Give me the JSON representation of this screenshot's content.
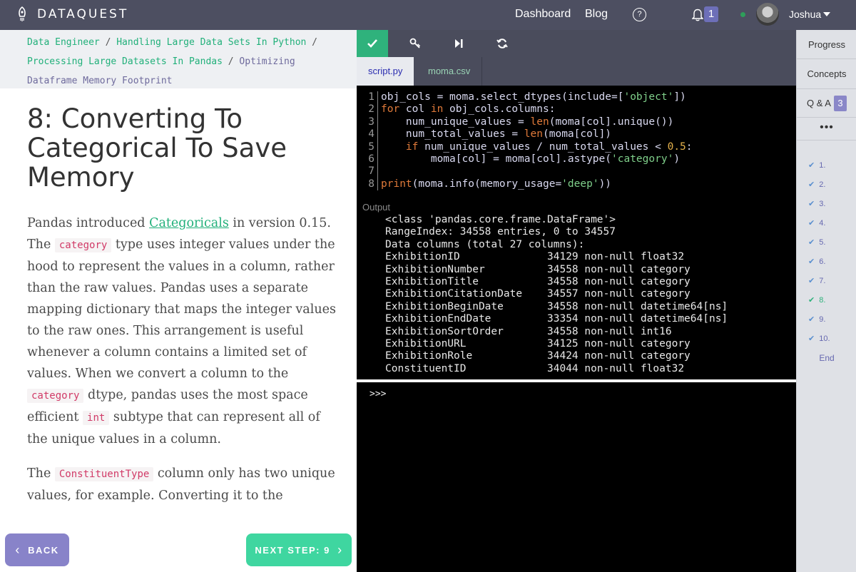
{
  "topbar": {
    "brand": "DATAQUEST",
    "nav": [
      "Dashboard",
      "Blog"
    ],
    "help_icon": "question-bubble-icon",
    "notifications": "1",
    "user": "Joshua"
  },
  "breadcrumb": {
    "items": [
      "Data Engineer",
      "Handling Large Data Sets In Python",
      "Processing Large Datasets In Pandas",
      "Optimizing Dataframe Memory Footprint"
    ],
    "separator": "/"
  },
  "lesson": {
    "title": "8: Converting To Categorical To Save Memory",
    "p1_a": "Pandas introduced ",
    "p1_link": "Categoricals",
    "p1_b": " in version 0.15. The ",
    "p1_code": "category",
    "p1_c": " type uses integer values under the hood to represent the values in a column, rather than the raw values. Pandas uses a separate mapping dictionary that maps the integer values to the raw ones. This arrangement is useful whenever a column contains a limited set of values. When we convert a column to the ",
    "p1_code2": "category",
    "p1_d": " dtype, pandas uses the most space efficient ",
    "p1_code3": "int",
    "p1_e": " subtype that can represent all of the unique values in a column.",
    "p2_a": "The ",
    "p2_code": "ConstituentType",
    "p2_b": " column only has two unique values, for example. Converting it to the"
  },
  "footer": {
    "back_label": "BACK",
    "next_label": "NEXT STEP: 9"
  },
  "editor": {
    "toolbar_icons": [
      "checkmark-icon",
      "key-icon",
      "step-forward-icon",
      "refresh-icon"
    ],
    "tabs": [
      "script.py",
      "moma.csv"
    ],
    "code_lines": [
      {
        "n": "1",
        "parts": [
          [
            "cl",
            "obj_cols = moma.select_dtypes(include=["
          ],
          [
            "str",
            "'object'"
          ],
          [
            "cl",
            "])"
          ]
        ]
      },
      {
        "n": "2",
        "parts": [
          [
            "kw",
            "for"
          ],
          [
            "cl",
            " col "
          ],
          [
            "kw",
            "in"
          ],
          [
            "cl",
            " obj_cols.columns:"
          ]
        ]
      },
      {
        "n": "3",
        "parts": [
          [
            "cl",
            "    num_unique_values = "
          ],
          [
            "kw",
            "len"
          ],
          [
            "cl",
            "(moma[col].unique())"
          ]
        ]
      },
      {
        "n": "4",
        "parts": [
          [
            "cl",
            "    num_total_values = "
          ],
          [
            "kw",
            "len"
          ],
          [
            "cl",
            "(moma[col])"
          ]
        ]
      },
      {
        "n": "5",
        "parts": [
          [
            "cl",
            "    "
          ],
          [
            "kw",
            "if"
          ],
          [
            "cl",
            " num_unique_values / num_total_values < "
          ],
          [
            "num",
            "0.5"
          ],
          [
            "cl",
            ":"
          ]
        ]
      },
      {
        "n": "6",
        "parts": [
          [
            "cl",
            "        moma[col] = moma[col].astype("
          ],
          [
            "str",
            "'category'"
          ],
          [
            "cl",
            ")"
          ]
        ]
      },
      {
        "n": "7",
        "parts": [
          [
            "cl",
            ""
          ]
        ]
      },
      {
        "n": "8",
        "parts": [
          [
            "kw",
            "print"
          ],
          [
            "cl",
            "(moma.info(memory_usage="
          ],
          [
            "str",
            "'deep'"
          ],
          [
            "cl",
            "))"
          ]
        ]
      }
    ],
    "output_label": "Output",
    "output_header": [
      "<class 'pandas.core.frame.DataFrame'>",
      "RangeIndex: 34558 entries, 0 to 34557",
      "Data columns (total 27 columns):"
    ],
    "output_rows": [
      [
        "ExhibitionID",
        "34129 non-null float32"
      ],
      [
        "ExhibitionNumber",
        "34558 non-null category"
      ],
      [
        "ExhibitionTitle",
        "34558 non-null category"
      ],
      [
        "ExhibitionCitationDate",
        "34557 non-null category"
      ],
      [
        "ExhibitionBeginDate",
        "34558 non-null datetime64[ns]"
      ],
      [
        "ExhibitionEndDate",
        "33354 non-null datetime64[ns]"
      ],
      [
        "ExhibitionSortOrder",
        "34558 non-null int16"
      ],
      [
        "ExhibitionURL",
        "34125 non-null category"
      ],
      [
        "ExhibitionRole",
        "34424 non-null category"
      ],
      [
        "ConstituentID",
        "34044 non-null float32"
      ]
    ],
    "prompt": ">>>"
  },
  "sidebar": {
    "progress": "Progress",
    "concepts": "Concepts",
    "qa": "Q & A",
    "qa_count": "3",
    "more": "•••",
    "steps": [
      "1.",
      "2.",
      "3.",
      "4.",
      "5.",
      "6.",
      "7.",
      "8.",
      "9.",
      "10."
    ],
    "current_step": "8.",
    "end": "End"
  }
}
